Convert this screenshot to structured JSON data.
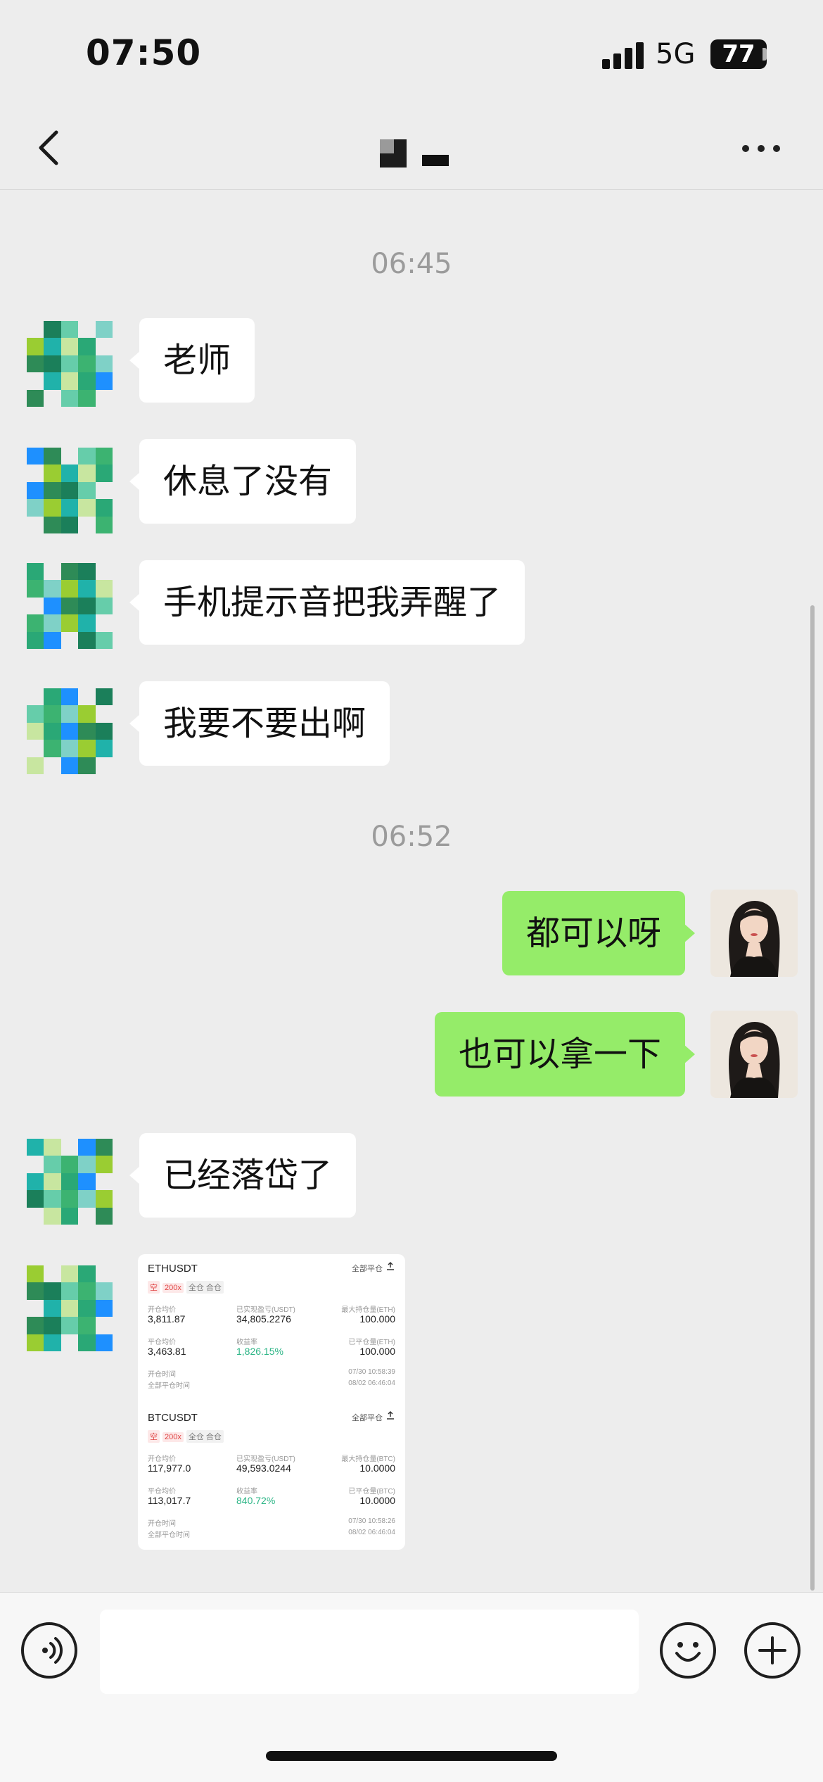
{
  "status_bar": {
    "time": "07:50",
    "network": "5G",
    "battery": "77"
  },
  "nav": {
    "back_icon": "chevron-left-icon",
    "title": "",
    "more_icon": "more-icon"
  },
  "chat": {
    "timestamps": [
      "06:45",
      "06:52"
    ],
    "messages": [
      {
        "from": "them",
        "text": "老师"
      },
      {
        "from": "them",
        "text": "休息了没有"
      },
      {
        "from": "them",
        "text": "手机提示音把我弄醒了"
      },
      {
        "from": "them",
        "text": "我要不要出啊"
      },
      {
        "from": "me",
        "text": "都可以呀"
      },
      {
        "from": "me",
        "text": "也可以拿一下"
      },
      {
        "from": "them",
        "text": "已经落岱了"
      }
    ]
  },
  "trade_card": {
    "positions": [
      {
        "symbol": "ETHUSDT",
        "close_all": "全部平仓",
        "tags": [
          "空",
          "200x",
          "全仓 合仓"
        ],
        "open_avg_label": "开仓均价",
        "open_avg": "3,811.87",
        "pnl_label": "已实现盈亏(USDT)",
        "pnl": "34,805.2276",
        "max_label": "最大持仓量(ETH)",
        "max": "100.000",
        "close_avg_label": "平仓均价",
        "close_avg": "3,463.81",
        "roi_label": "收益率",
        "roi": "1,826.15%",
        "closed_label": "已平仓量(ETH)",
        "closed": "100.000",
        "open_time_label": "开仓时间",
        "open_time": "07/30 10:58:39",
        "close_time_label": "全部平仓时间",
        "close_time": "08/02 06:46:04"
      },
      {
        "symbol": "BTCUSDT",
        "close_all": "全部平仓",
        "tags": [
          "空",
          "200x",
          "全仓 合仓"
        ],
        "open_avg_label": "开仓均价",
        "open_avg": "117,977.0",
        "pnl_label": "已实现盈亏(USDT)",
        "pnl": "49,593.0244",
        "max_label": "最大持仓量(BTC)",
        "max": "10.0000",
        "close_avg_label": "平仓均价",
        "close_avg": "113,017.7",
        "roi_label": "收益率",
        "roi": "840.72%",
        "closed_label": "已平仓量(BTC)",
        "closed": "10.0000",
        "open_time_label": "开仓时间",
        "open_time": "07/30 10:58:26",
        "close_time_label": "全部平仓时间",
        "close_time": "08/02 06:46:04"
      }
    ]
  },
  "input_bar": {
    "voice_icon": "voice-icon",
    "emoji_icon": "emoji-icon",
    "plus_icon": "plus-icon",
    "input_value": ""
  },
  "colors": {
    "background": "#ededed",
    "my_bubble": "#95ec69",
    "their_bubble": "#ffffff",
    "profit_green": "#2cb586",
    "tag_red": "#e04646"
  }
}
